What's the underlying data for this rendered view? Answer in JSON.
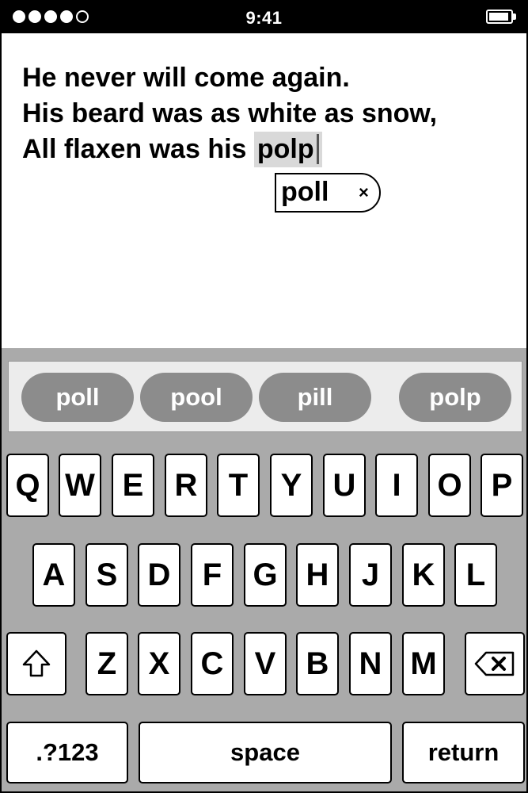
{
  "status_bar": {
    "signal_dots": [
      true,
      true,
      true,
      true,
      false
    ],
    "time": "9:41",
    "battery_icon": "battery-full-icon"
  },
  "document": {
    "lines": [
      "He never will come again.",
      "His beard was as white as snow,"
    ],
    "last_line_prefix": "All flaxen was his ",
    "current_word": "polp"
  },
  "autocorrect": {
    "suggestion": "poll",
    "dismiss": "×"
  },
  "suggestions": [
    "poll",
    "pool",
    "pill",
    "polp"
  ],
  "keyboard": {
    "row1": [
      "Q",
      "W",
      "E",
      "R",
      "T",
      "Y",
      "U",
      "I",
      "O",
      "P"
    ],
    "row2": [
      "A",
      "S",
      "D",
      "F",
      "G",
      "H",
      "J",
      "K",
      "L"
    ],
    "row3": [
      "Z",
      "X",
      "C",
      "V",
      "B",
      "N",
      "M"
    ],
    "shift_icon": "shift-arrow-icon",
    "delete_icon": "delete-backspace-icon",
    "numbers_label": ".?123",
    "space_label": "space",
    "return_label": "return"
  },
  "colors": {
    "keyboard_bg": "#aaaaaa",
    "suggestion_pill": "#8c8c8c",
    "highlight": "#d9d9d9"
  }
}
